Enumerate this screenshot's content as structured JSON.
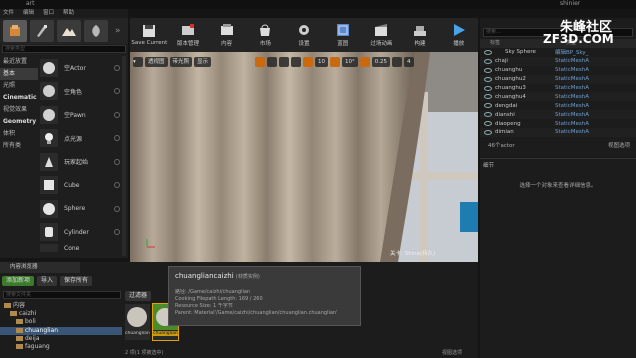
{
  "title_bar": {
    "left_label": "art",
    "right_label": "shinier"
  },
  "menu": [
    "文件",
    "编辑",
    "窗口",
    "帮助"
  ],
  "mode_more": "»",
  "toolbar": [
    {
      "label": "Save Current",
      "icon": "save-icon"
    },
    {
      "label": "版本管理",
      "icon": "source-control-icon"
    },
    {
      "label": "内容",
      "icon": "content-icon"
    },
    {
      "label": "市场",
      "icon": "marketplace-icon"
    },
    {
      "label": "设置",
      "icon": "settings-icon"
    },
    {
      "label": "蓝图",
      "icon": "blueprint-icon"
    },
    {
      "label": "过场动画",
      "icon": "cinematics-icon"
    },
    {
      "label": "构建",
      "icon": "build-icon"
    },
    {
      "label": "播放",
      "icon": "play-icon"
    }
  ],
  "place_panel": {
    "search_placeholder": "搜索类型",
    "categories": [
      {
        "label": "最近放置",
        "selected": false,
        "bold": false
      },
      {
        "label": "基本",
        "selected": true,
        "bold": false
      },
      {
        "label": "光照",
        "selected": false,
        "bold": false
      },
      {
        "label": "Cinematic",
        "selected": false,
        "bold": true
      },
      {
        "label": "视觉效果",
        "selected": false,
        "bold": false
      },
      {
        "label": "Geometry",
        "selected": false,
        "bold": true
      },
      {
        "label": "体积",
        "selected": false,
        "bold": false
      },
      {
        "label": "所有类",
        "selected": false,
        "bold": false
      }
    ],
    "items": [
      {
        "label": "空Actor",
        "icon": "empty-actor-icon"
      },
      {
        "label": "空角色",
        "icon": "character-icon"
      },
      {
        "label": "空Pawn",
        "icon": "pawn-icon"
      },
      {
        "label": "点光源",
        "icon": "point-light-icon"
      },
      {
        "label": "玩家起始",
        "icon": "player-start-icon"
      },
      {
        "label": "Cube",
        "icon": "cube-icon"
      },
      {
        "label": "Sphere",
        "icon": "sphere-icon"
      },
      {
        "label": "Cylinder",
        "icon": "cylinder-icon"
      },
      {
        "label": "Cone",
        "icon": "cone-icon"
      }
    ]
  },
  "viewport": {
    "perspective": "透视图",
    "lit": "带光照",
    "show": "显示",
    "grid_value": "10",
    "rotation_value": "10°",
    "scale_value": "0.25",
    "camera_speed": "4",
    "overlay_text": "关卡: Shine(持久)"
  },
  "outliner": {
    "search_placeholder": "搜索...",
    "col_label": "标签",
    "col_type": "类型",
    "rows": [
      {
        "name": "Sky Sphere",
        "type": "编辑BP_Sky_"
      },
      {
        "name": "chaji",
        "type": "StaticMeshA"
      },
      {
        "name": "chuanghu",
        "type": "StaticMeshA"
      },
      {
        "name": "chuanghu2",
        "type": "StaticMeshA"
      },
      {
        "name": "chuanghu3",
        "type": "StaticMeshA"
      },
      {
        "name": "chuanghu4",
        "type": "StaticMeshA"
      },
      {
        "name": "dengdai",
        "type": "StaticMeshA"
      },
      {
        "name": "dianshi",
        "type": "StaticMeshA"
      },
      {
        "name": "diaopeng",
        "type": "StaticMeshA"
      },
      {
        "name": "dimian",
        "type": "StaticMeshA"
      }
    ],
    "count": "46个actor",
    "view_options": "视图选项"
  },
  "details": {
    "tab": "细节",
    "message": "选择一个对象来查看详细信息。"
  },
  "content_browser": {
    "tab": "内容浏览器",
    "add_new": "添加新项",
    "import": "导入",
    "save_all": "保存所有",
    "search_placeholder": "搜索文件夹",
    "filter_label": "过滤器",
    "tree": [
      {
        "label": "内容",
        "indent": 0,
        "selected": false
      },
      {
        "label": "caizhi",
        "indent": 1,
        "selected": false
      },
      {
        "label": "boli",
        "indent": 2,
        "selected": false
      },
      {
        "label": "chuanglian",
        "indent": 2,
        "selected": true
      },
      {
        "label": "deija",
        "indent": 2,
        "selected": false
      },
      {
        "label": "faguang",
        "indent": 2,
        "selected": false
      }
    ],
    "assets": [
      {
        "label": "chuanglian"
      },
      {
        "label": "chuanglianca"
      }
    ],
    "status": "2 项(1 项被选中)",
    "view_options": "视图选项"
  },
  "tooltip": {
    "title": "chuangliancaizhi",
    "subtitle": "(材质实例)",
    "lines": [
      "路径: /Game/caizhi/chuanglian",
      "Cooking Filepath Length: 169 / 260",
      "Resource Size: 1 千字节",
      "Parent: Material'/Game/caizhi/chuanglian/chuanglian.chuanglian'"
    ]
  },
  "watermark": {
    "cn": "朱峰社区",
    "en": "ZF3D.COM"
  },
  "colors": {
    "accent_orange": "#c96a10",
    "select_blue": "#3a5676",
    "add_green": "#3a7a2a"
  }
}
